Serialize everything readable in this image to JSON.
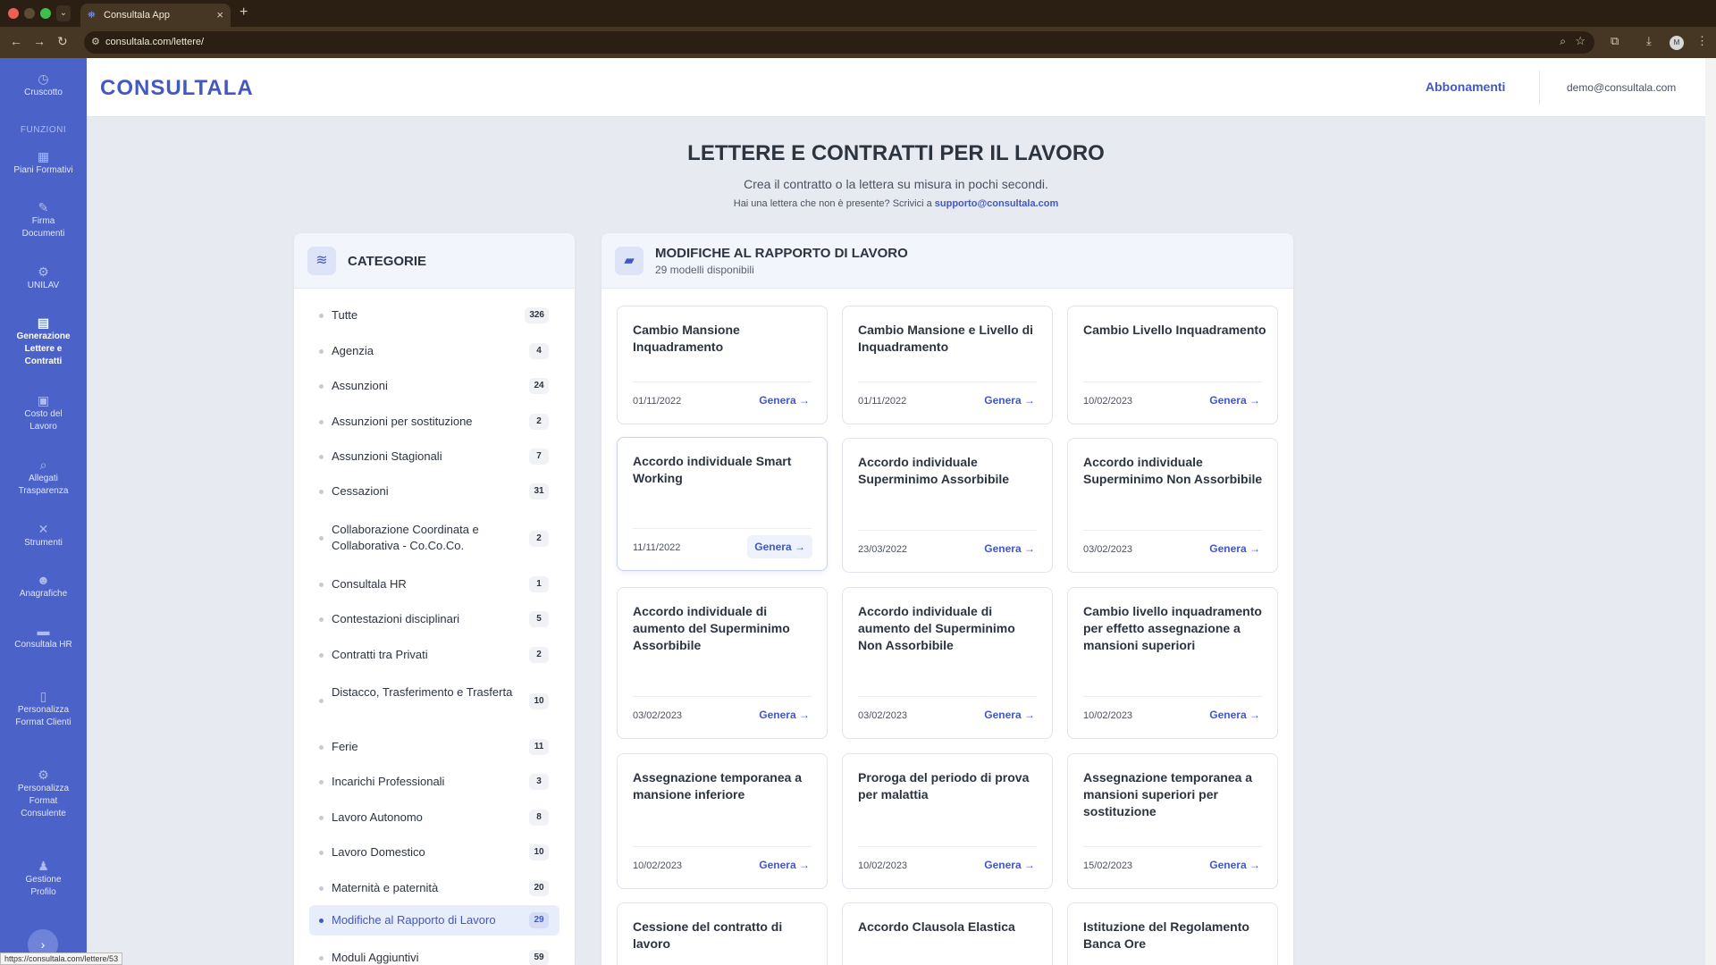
{
  "browser": {
    "tab_title": "Consultala App",
    "url": "consultala.com/lettere/",
    "profile_initial": "M",
    "status_url": "https://consultala.com/lettere/53"
  },
  "sidebar": {
    "top_item": {
      "label": "Cruscotto",
      "icon": "dashboard-icon"
    },
    "section_label": "FUNZIONI",
    "items": [
      {
        "label": "Piani Formativi",
        "icon": "table-icon"
      },
      {
        "label": "Firma Documenti",
        "icon": "signature-icon"
      },
      {
        "label": "UNILAV",
        "icon": "gear-icon"
      },
      {
        "label": "Generazione Lettere e Contratti",
        "icon": "document-icon",
        "active": true
      },
      {
        "label": "Costo del Lavoro",
        "icon": "calculator-icon"
      },
      {
        "label": "Allegati Trasparenza",
        "icon": "search-icon"
      },
      {
        "label": "Strumenti",
        "icon": "tools-icon"
      },
      {
        "label": "Anagrafiche",
        "icon": "users-icon"
      },
      {
        "label": "Consultala HR",
        "icon": "folder-icon"
      },
      {
        "label": "Personalizza Format Clienti",
        "icon": "file-icon"
      },
      {
        "label": "Personalizza Format Consulente",
        "icon": "settings-icon"
      },
      {
        "label": "Gestione Profilo",
        "icon": "user-icon"
      }
    ]
  },
  "header": {
    "logo": "CONSULTALA",
    "link": "Abbonamenti",
    "email": "demo@consultala.com"
  },
  "page": {
    "title": "LETTERE E CONTRATTI PER IL LAVORO",
    "subtitle": "Crea il contratto o la lettera su misura in pochi secondi.",
    "note": "Hai una lettera che non è presente? Scrivici a",
    "note_link": "supporto@consultala.com"
  },
  "categories": {
    "title": "CATEGORIE",
    "items": [
      {
        "name": "Tutte",
        "count": "326"
      },
      {
        "name": "Agenzia",
        "count": "4"
      },
      {
        "name": "Assunzioni",
        "count": "24"
      },
      {
        "name": "Assunzioni per sostituzione",
        "count": "2"
      },
      {
        "name": "Assunzioni Stagionali",
        "count": "7"
      },
      {
        "name": "Cessazioni",
        "count": "31"
      },
      {
        "name": "Collaborazione Coordinata e Collaborativa - Co.Co.Co.",
        "count": "2"
      },
      {
        "name": "Consultala HR",
        "count": "1"
      },
      {
        "name": "Contestazioni disciplinari",
        "count": "5"
      },
      {
        "name": "Contratti tra Privati",
        "count": "2"
      },
      {
        "name": "Distacco, Trasferimento e Trasferta",
        "count": "10"
      },
      {
        "name": "Ferie",
        "count": "11"
      },
      {
        "name": "Incarichi Professionali",
        "count": "3"
      },
      {
        "name": "Lavoro Autonomo",
        "count": "8"
      },
      {
        "name": "Lavoro Domestico",
        "count": "10"
      },
      {
        "name": "Maternità e paternità",
        "count": "20"
      },
      {
        "name": "Modifiche al Rapporto di Lavoro",
        "count": "29",
        "active": true
      },
      {
        "name": "Moduli Aggiuntivi",
        "count": "59"
      }
    ]
  },
  "models": {
    "title": "MODIFICHE AL RAPPORTO DI LAVORO",
    "subtitle": "29 modelli disponibili",
    "action_label": "Genera",
    "cards": [
      {
        "title": "Cambio Mansione Inquadramento",
        "date": "01/11/2022"
      },
      {
        "title": "Cambio Mansione e Livello di Inquadramento",
        "date": "01/11/2022"
      },
      {
        "title": "Cambio Livello Inquadramento",
        "date": "10/02/2023"
      },
      {
        "title": "Accordo individuale Smart Working",
        "date": "11/11/2022"
      },
      {
        "title": "Accordo individuale Superminimo Assorbibile",
        "date": "23/03/2022"
      },
      {
        "title": "Accordo individuale Superminimo Non Assorbibile",
        "date": "03/02/2023"
      },
      {
        "title": "Accordo individuale di aumento del Superminimo Assorbibile",
        "date": "03/02/2023"
      },
      {
        "title": "Accordo individuale di aumento del Superminimo Non Assorbibile",
        "date": "03/02/2023"
      },
      {
        "title": "Cambio livello inquadramento per effetto assegnazione a mansioni superiori",
        "date": "10/02/2023"
      },
      {
        "title": "Assegnazione temporanea a mansione inferiore",
        "date": "10/02/2023"
      },
      {
        "title": "Proroga del periodo di prova per malattia",
        "date": "10/02/2023"
      },
      {
        "title": "Assegnazione temporanea a mansioni superiori per sostituzione",
        "date": "15/02/2023"
      },
      {
        "title": "Cessione del contratto di lavoro",
        "date": ""
      },
      {
        "title": "Accordo Clausola Elastica",
        "date": ""
      },
      {
        "title": "Istituzione del Regolamento Banca Ore",
        "date": ""
      }
    ]
  }
}
